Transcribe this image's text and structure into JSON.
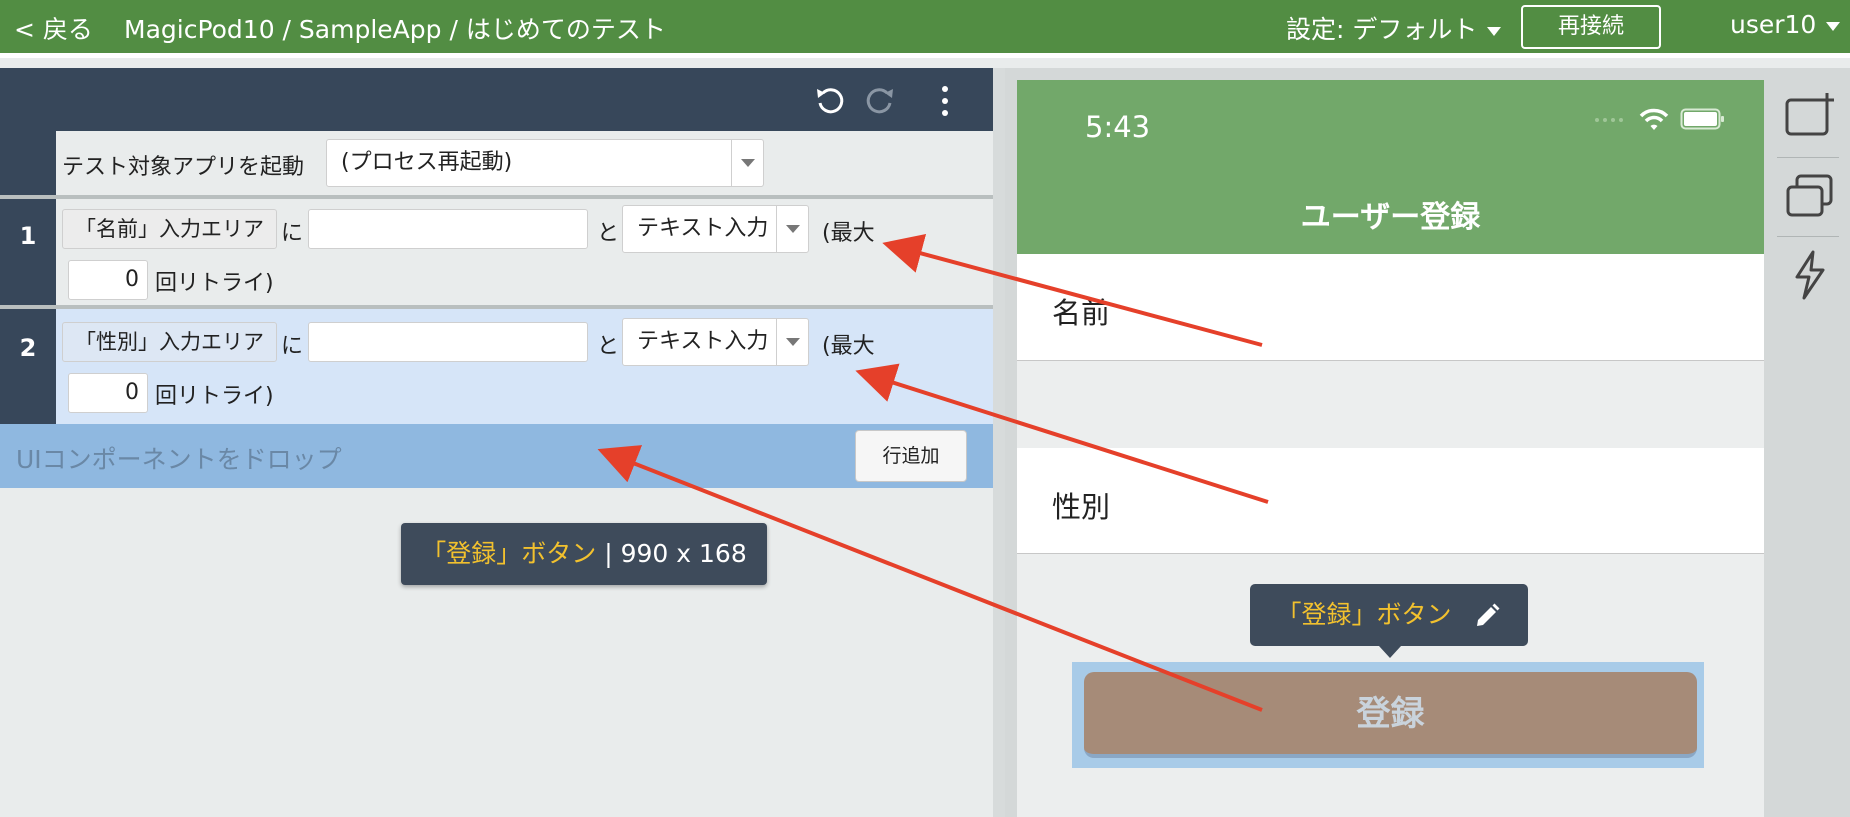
{
  "header": {
    "back_label": "< 戻る",
    "breadcrumb": "MagicPod10 / SampleApp / はじめてのテスト",
    "settings_label": "設定: デフォルト",
    "reconnect_label": "再接続",
    "user_label": "user10"
  },
  "editor": {
    "launch_row": {
      "label": "テスト対象アプリを起動",
      "option": "(プロセス再起動)"
    },
    "steps": [
      {
        "number": "1",
        "element": "「名前」入力エリア",
        "particle_ni": "に",
        "text_value": "",
        "particle_to": "と",
        "action": "テキスト入力",
        "max_label": "(最大",
        "retry_count": "0",
        "retry_label": "回リトライ)"
      },
      {
        "number": "2",
        "element": "「性別」入力エリア",
        "particle_ni": "に",
        "text_value": "",
        "particle_to": "と",
        "action": "テキスト入力",
        "max_label": "(最大",
        "retry_count": "0",
        "retry_label": "回リトライ)"
      }
    ],
    "dropzone_label": "UIコンポーネントをドロップ",
    "add_row_label": "行追加",
    "size_tooltip": {
      "name": "「登録」ボタン",
      "size": " | 990 x 168"
    }
  },
  "device": {
    "time": "5:43",
    "title": "ユーザー登録",
    "fields": [
      "名前",
      "性別"
    ],
    "tooltip_label": "「登録」ボタン",
    "register_button": "登録"
  },
  "colors": {
    "header_green": "#528d43",
    "phone_header_green": "#72a86a",
    "toolbar_navy": "#37475a",
    "selected_row_blue": "#d6e5f8",
    "dropzone_blue": "#8fb8e0",
    "annotation_red": "#e5402a",
    "tooltip_accent": "#f2c12e"
  }
}
